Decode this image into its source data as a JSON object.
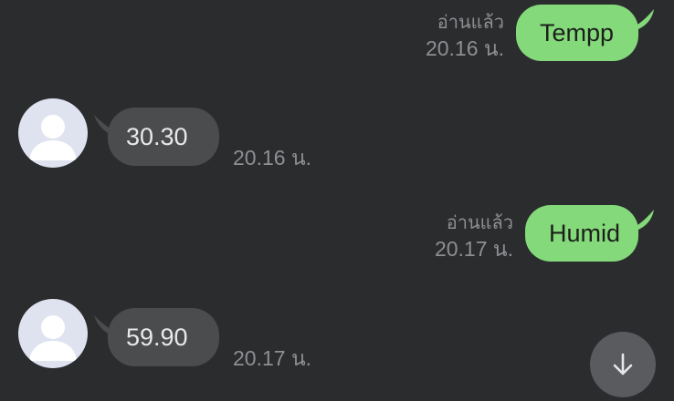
{
  "messages": [
    {
      "direction": "out",
      "text": "Tempp",
      "read_label": "อ่านแล้ว",
      "time": "20.16 น."
    },
    {
      "direction": "in",
      "text": "30.30",
      "time": "20.16 น."
    },
    {
      "direction": "out",
      "text": "Humid",
      "read_label": "อ่านแล้ว",
      "time": "20.17 น."
    },
    {
      "direction": "in",
      "text": "59.90",
      "time": "20.17 น."
    }
  ],
  "icons": {
    "avatar": "default-user-avatar-icon",
    "scroll": "arrow-down-icon"
  },
  "colors": {
    "background": "#2b2c2e",
    "outgoing_bubble": "#84d97a",
    "incoming_bubble": "#4b4c4e",
    "meta_text": "#8d8f92",
    "scroll_button": "#5a5b5e"
  }
}
